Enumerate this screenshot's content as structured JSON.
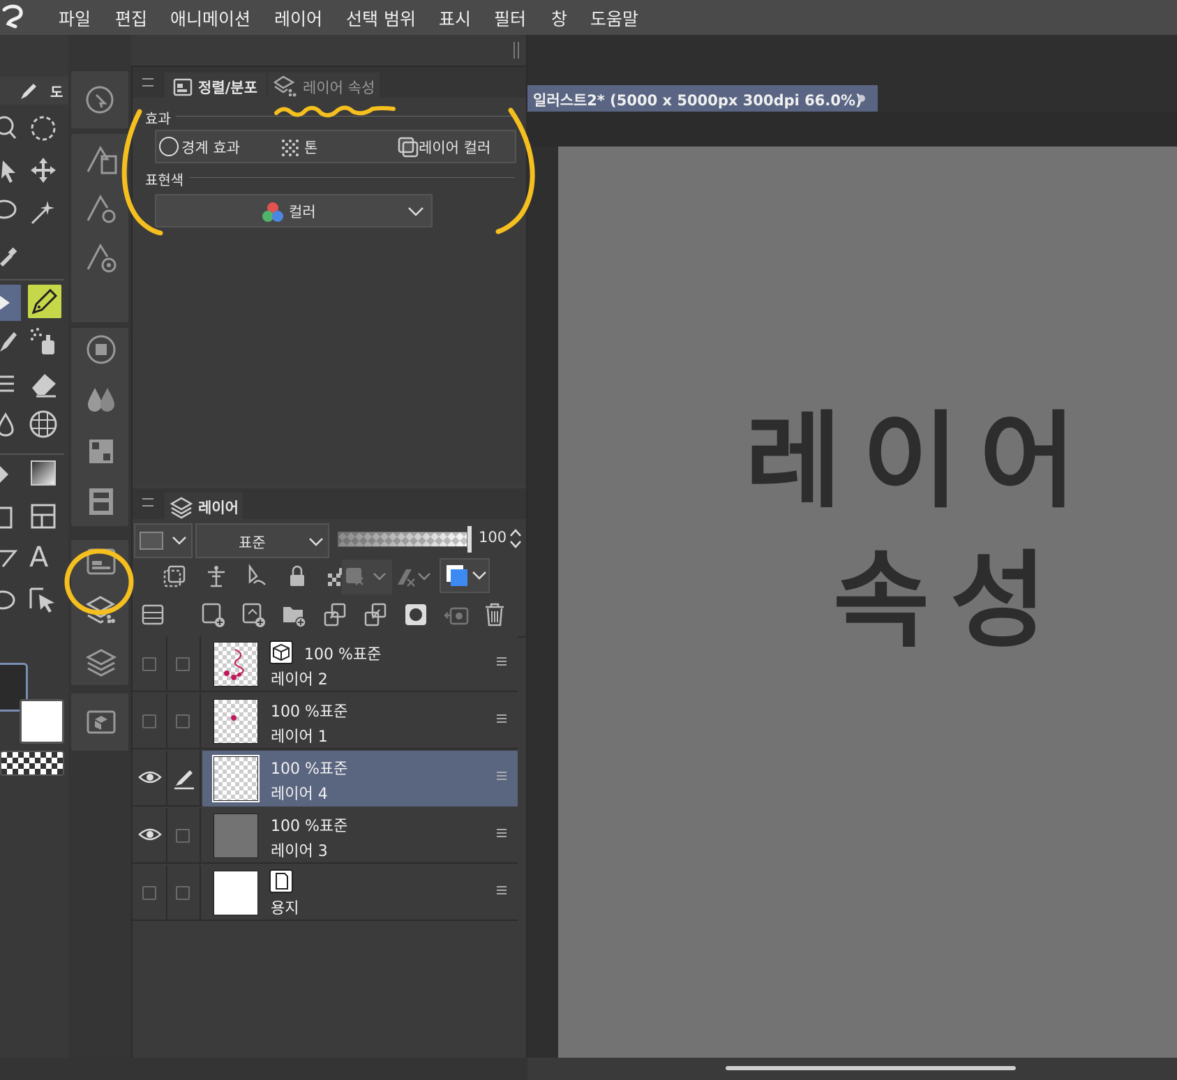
{
  "menubar": {
    "items": [
      "파일",
      "편집",
      "애니메이션",
      "레이어",
      "선택 범위",
      "표시",
      "필터",
      "창",
      "도움말"
    ]
  },
  "properties_panel": {
    "tab_align": "정렬/분포",
    "tab_layer_property": "레이어 속성",
    "effect_group_label": "효과",
    "effect_border": "경계 효과",
    "effect_tone": "톤",
    "effect_layer_color": "레이어 컬러",
    "expression_color_label": "표현색",
    "expression_color_value": "컬러"
  },
  "layer_panel": {
    "tab_label": "레이어",
    "blend_mode": "표준",
    "opacity": "100",
    "layers": [
      {
        "opacity_mode": "100 %표준",
        "name": "레이어 2",
        "visible": false,
        "selected": false
      },
      {
        "opacity_mode": "100 %표준",
        "name": "레이어 1",
        "visible": false,
        "selected": false
      },
      {
        "opacity_mode": "100 %표준",
        "name": "레이어 4",
        "visible": true,
        "selected": true
      },
      {
        "opacity_mode": "100 %표준",
        "name": "레이어 3",
        "visible": true,
        "selected": false
      },
      {
        "opacity_mode": "",
        "name": "용지",
        "visible": false,
        "selected": false
      }
    ]
  },
  "canvas": {
    "document_tab": "일러스트2* (5000 x 5000px 300dpi 66.0%)",
    "handwriting_line1": "레이어",
    "handwriting_line2": "속성"
  },
  "tool_palette": {
    "partial_label": "도"
  },
  "colors": {
    "highlight_yellow": "#f5bf1f",
    "selection_blue": "#5a6580",
    "accent_blue": "#3d8bf2",
    "canvas_gray": "#737373"
  }
}
